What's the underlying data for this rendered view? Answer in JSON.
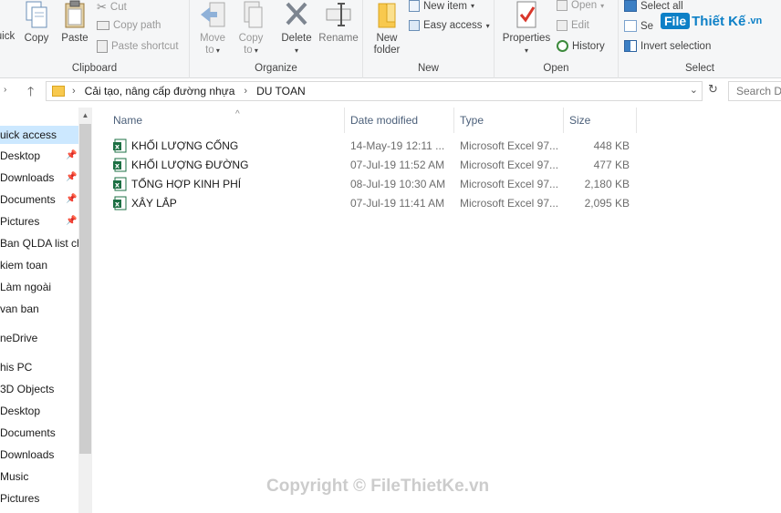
{
  "ribbon": {
    "clipboard": {
      "label": "Clipboard",
      "quick_label": "uick",
      "copy_label": "Copy",
      "paste_label": "Paste",
      "cut_label": "Cut",
      "copy_path_label": "Copy path",
      "paste_shortcut_label": "Paste shortcut"
    },
    "organize": {
      "label": "Organize",
      "move_to_line1": "Move",
      "move_to_line2": "to",
      "copy_to_line1": "Copy",
      "copy_to_line2": "to",
      "delete_label": "Delete",
      "rename_label": "Rename"
    },
    "new": {
      "label": "New",
      "new_folder_line1": "New",
      "new_folder_line2": "folder",
      "new_item_label": "New item",
      "easy_access_label": "Easy access"
    },
    "open": {
      "label": "Open",
      "properties_label": "Properties",
      "open_label": "Open",
      "edit_label": "Edit",
      "history_label": "History"
    },
    "select": {
      "label": "Select",
      "select_all_label": "Select all",
      "select_none_label": "Se",
      "invert_label": "Invert selection"
    }
  },
  "logo": {
    "box": "File",
    "text": "Thiết Kế",
    "suffix": ".vn"
  },
  "address": {
    "crumbs": [
      "Cải tạo, nâng cấp đường nhựa",
      "DU TOAN"
    ],
    "search_placeholder": "Search DU"
  },
  "nav": {
    "items": [
      {
        "label": "uick access",
        "active": true
      },
      {
        "label": "Desktop",
        "pinned": true
      },
      {
        "label": "Downloads",
        "pinned": true
      },
      {
        "label": "Documents",
        "pinned": true
      },
      {
        "label": "Pictures",
        "pinned": true
      },
      {
        "label": "Ban QLDA list ch"
      },
      {
        "label": "kiem toan"
      },
      {
        "label": "Làm ngoài"
      },
      {
        "label": "van ban"
      },
      {
        "label": "neDrive"
      },
      {
        "label": "his PC"
      },
      {
        "label": "3D Objects"
      },
      {
        "label": "Desktop"
      },
      {
        "label": "Documents"
      },
      {
        "label": "Downloads"
      },
      {
        "label": "Music"
      },
      {
        "label": "Pictures"
      }
    ]
  },
  "columns": {
    "name": "Name",
    "date": "Date modified",
    "type": "Type",
    "size": "Size"
  },
  "files": [
    {
      "name": "KHỐI LƯỢNG CỐNG",
      "date": "14-May-19 12:11 ...",
      "type": "Microsoft Excel 97...",
      "size": "448 KB"
    },
    {
      "name": "KHỐI LƯỢNG ĐƯỜNG",
      "date": "07-Jul-19 11:52 AM",
      "type": "Microsoft Excel 97...",
      "size": "477 KB"
    },
    {
      "name": "TỔNG HỢP KINH PHÍ",
      "date": "08-Jul-19 10:30 AM",
      "type": "Microsoft Excel 97...",
      "size": "2,180 KB"
    },
    {
      "name": "XÂY LẮP",
      "date": "07-Jul-19 11:41 AM",
      "type": "Microsoft Excel 97...",
      "size": "2,095 KB"
    }
  ],
  "watermark": "Copyright © FileThietKe.vn",
  "colors": {
    "accent": "#0d80c7",
    "selection": "#cce8ff",
    "excel": "#1d7044"
  }
}
